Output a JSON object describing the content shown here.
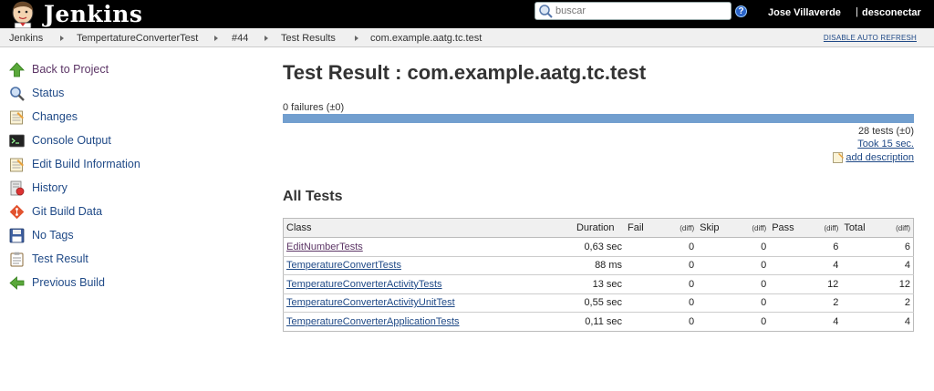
{
  "header": {
    "logo_text": "Jenkins",
    "search_placeholder": "buscar",
    "user_name": "Jose Villaverde",
    "separator": "|",
    "logout_label": "desconectar"
  },
  "breadcrumb": {
    "items": [
      "Jenkins",
      "TempertatureConverterTest",
      "#44",
      "Test Results",
      "com.example.aatg.tc.test"
    ],
    "auto_refresh_label": "DISABLE AUTO REFRESH"
  },
  "sidebar": {
    "items": [
      {
        "label": "Back to Project",
        "icon": "green-up-arrow-icon"
      },
      {
        "label": "Status",
        "icon": "magnifier-icon"
      },
      {
        "label": "Changes",
        "icon": "notepad-icon"
      },
      {
        "label": "Console Output",
        "icon": "terminal-icon"
      },
      {
        "label": "Edit Build Information",
        "icon": "notepad-edit-icon"
      },
      {
        "label": "History",
        "icon": "history-icon"
      },
      {
        "label": "Git Build Data",
        "icon": "git-icon"
      },
      {
        "label": "No Tags",
        "icon": "floppy-save-icon"
      },
      {
        "label": "Test Result",
        "icon": "clipboard-icon"
      },
      {
        "label": "Previous Build",
        "icon": "green-left-arrow-icon"
      }
    ]
  },
  "main": {
    "title": "Test Result : com.example.aatg.tc.test",
    "failures_label": "0 failures (±0)",
    "pass_fraction": 1.0,
    "tests_count": "28 tests (±0)",
    "took_label": "Took 15 sec.",
    "add_description_label": "add description",
    "all_tests_heading": "All Tests",
    "table": {
      "headers": {
        "class": "Class",
        "duration": "Duration",
        "fail": "Fail",
        "diff": "(diff)",
        "skip": "Skip",
        "pass": "Pass",
        "total": "Total"
      },
      "rows": [
        {
          "class": "EditNumberTests",
          "duration": "0,63 sec",
          "fail": "0",
          "skip": "0",
          "pass": "6",
          "total": "6"
        },
        {
          "class": "TemperatureConvertTests",
          "duration": "88 ms",
          "fail": "0",
          "skip": "0",
          "pass": "4",
          "total": "4"
        },
        {
          "class": "TemperatureConverterActivityTests",
          "duration": "13 sec",
          "fail": "0",
          "skip": "0",
          "pass": "12",
          "total": "12"
        },
        {
          "class": "TemperatureConverterActivityUnitTest",
          "duration": "0,55 sec",
          "fail": "0",
          "skip": "0",
          "pass": "2",
          "total": "2"
        },
        {
          "class": "TemperatureConverterApplicationTests",
          "duration": "0,11 sec",
          "fail": "0",
          "skip": "0",
          "pass": "4",
          "total": "4"
        }
      ]
    }
  },
  "colors": {
    "header_bg": "#000000",
    "link": "#204a87",
    "visited_link": "#5c3566",
    "progress_pass": "#729fcf"
  }
}
